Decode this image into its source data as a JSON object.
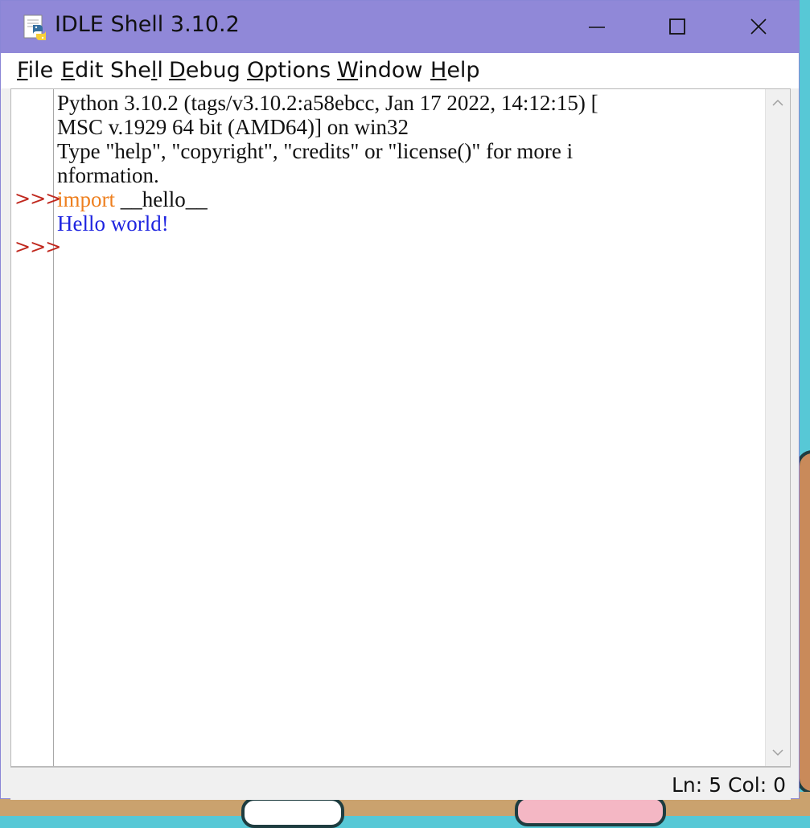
{
  "window": {
    "title": "IDLE Shell 3.10.2",
    "app_icon": "python-idle-icon",
    "controls": [
      "minimize-icon",
      "maximize-icon",
      "close-icon"
    ]
  },
  "menu": {
    "file": {
      "underline": "F",
      "rest": "ile"
    },
    "edit": {
      "underline": "E",
      "rest": "dit"
    },
    "shell": {
      "pre": "She",
      "underline": "l",
      "rest": "l"
    },
    "debug": {
      "underline": "D",
      "rest": "ebug"
    },
    "options": {
      "underline": "O",
      "rest": "ptions"
    },
    "window": {
      "underline": "W",
      "rest": "indow"
    },
    "help": {
      "underline": "H",
      "rest": "elp"
    }
  },
  "shell": {
    "prompt": ">>>",
    "lines": {
      "banner1": "Python 3.10.2 (tags/v3.10.2:a58ebcc, Jan 17 2022, 14:12:15) [",
      "banner2": "MSC v.1929 64 bit (AMD64)] on win32",
      "banner3": "Type \"help\", \"copyright\", \"credits\" or \"license()\" for more i",
      "banner4": "nformation.",
      "input_keyword": "import",
      "input_rest": " __hello__",
      "output": "Hello world!"
    }
  },
  "status": {
    "line": "Ln: 5",
    "col": "Col: 0"
  },
  "colors": {
    "titlebar": "#9088d8",
    "prompt": "#c0281e",
    "keyword": "#ee7f1e",
    "output": "#1e24e0"
  }
}
